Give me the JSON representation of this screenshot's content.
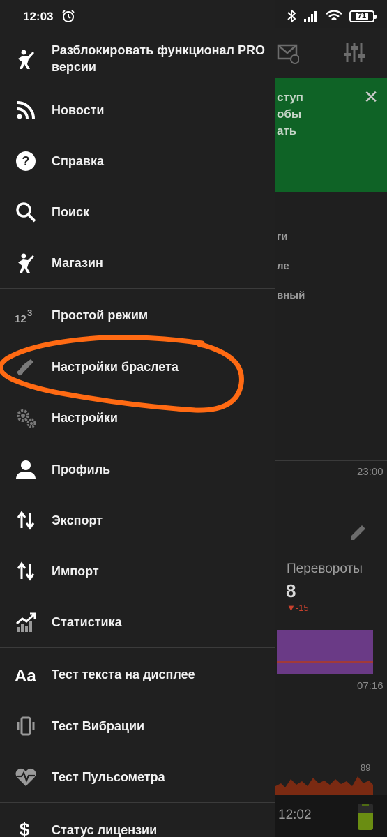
{
  "status_bar": {
    "time": "12:03",
    "battery": "71"
  },
  "drawer": {
    "items": [
      {
        "label_line1": "Разблокировать функционал PRO",
        "label_line2": "версии",
        "icon": "unlock-figure-icon"
      },
      {
        "label": "Новости",
        "icon": "rss-icon"
      },
      {
        "label": "Справка",
        "icon": "help-icon"
      },
      {
        "label": "Поиск",
        "icon": "search-icon"
      },
      {
        "label": "Магазин",
        "icon": "shop-figure-icon"
      },
      {
        "label": "Простой режим",
        "icon": "simple-mode-123-icon"
      },
      {
        "label": "Настройки браслета",
        "icon": "bracelet-icon"
      },
      {
        "label": "Настройки",
        "icon": "gears-icon"
      },
      {
        "label": "Профиль",
        "icon": "person-icon"
      },
      {
        "label": "Экспорт",
        "icon": "arrows-updown-icon"
      },
      {
        "label": "Импорт",
        "icon": "arrows-updown-icon"
      },
      {
        "label": "Статистика",
        "icon": "stats-chart-icon"
      },
      {
        "label": "Тест текста на дисплее",
        "icon": "text-aa-icon"
      },
      {
        "label": "Тест Вибрации",
        "icon": "vibration-icon"
      },
      {
        "label": "Тест Пульсометра",
        "icon": "heart-pulse-icon"
      },
      {
        "label": "Статус лицензии",
        "icon": "dollar-icon"
      }
    ]
  },
  "background": {
    "banner_lines": [
      "ступ",
      "обы",
      "ать"
    ],
    "list_lines": [
      "ги",
      "ле",
      "вный"
    ],
    "time_right": "23:00",
    "turns_label": "Перевороты",
    "turns_value": "8",
    "turns_delta": "▼-15",
    "time_chart": "07:16",
    "hr_value": "89",
    "bottom_clock": "12:02"
  },
  "colors": {
    "drawer_bg": "#202020",
    "highlight": "#ff6a13",
    "banner_green": "#0f6326"
  }
}
